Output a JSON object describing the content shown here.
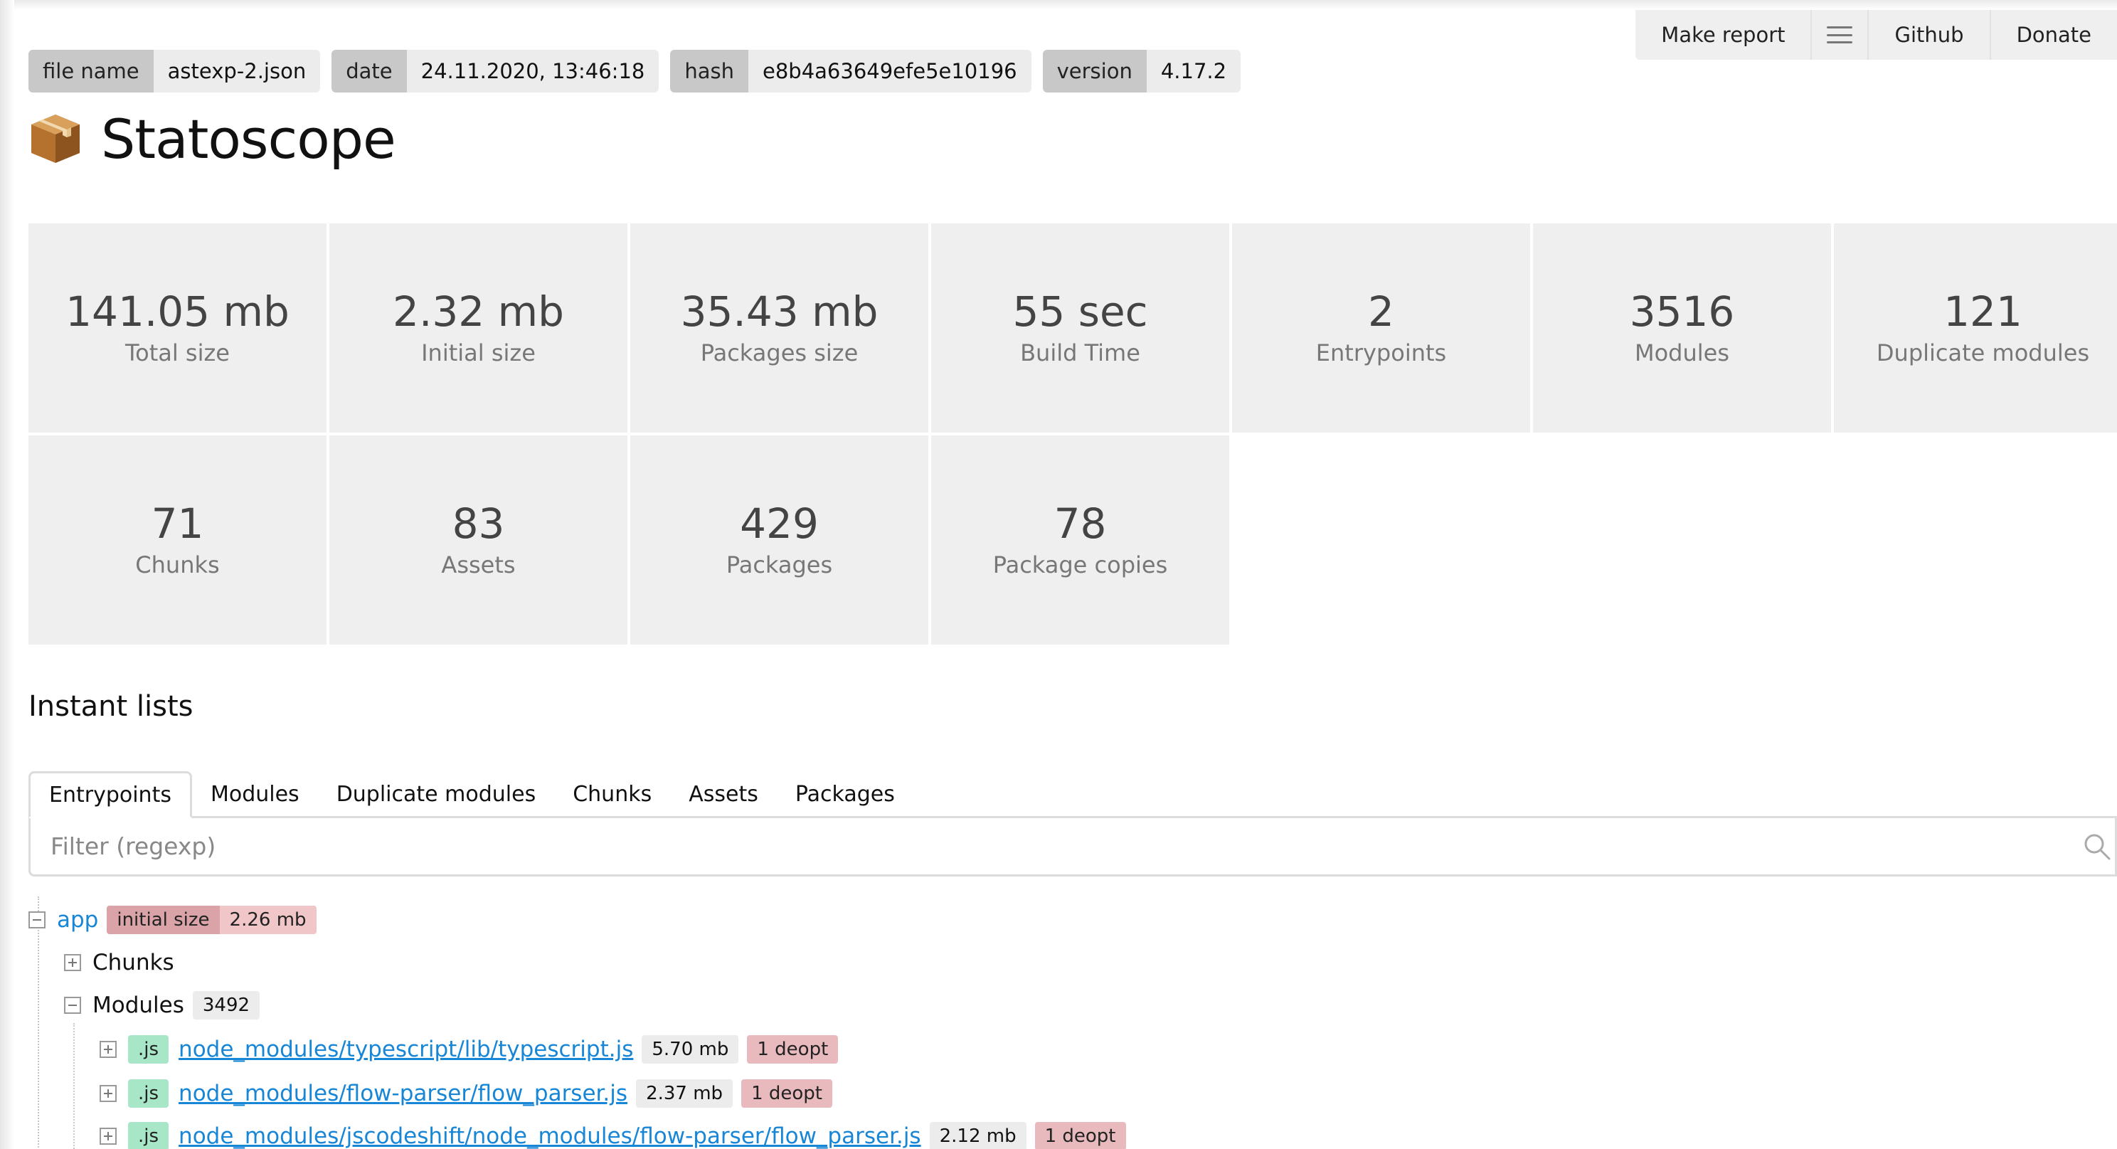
{
  "nav": {
    "make_report": "Make report",
    "github": "Github",
    "donate": "Donate"
  },
  "meta": {
    "file_name": {
      "key": "file name",
      "value": "astexp-2.json"
    },
    "date": {
      "key": "date",
      "value": "24.11.2020, 13:46:18"
    },
    "hash": {
      "key": "hash",
      "value": "e8b4a63649efe5e10196"
    },
    "version": {
      "key": "version",
      "value": "4.17.2"
    }
  },
  "app_title": "Statoscope",
  "stats": [
    {
      "value": "141.05 mb",
      "label": "Total size"
    },
    {
      "value": "2.32 mb",
      "label": "Initial size"
    },
    {
      "value": "35.43 mb",
      "label": "Packages size"
    },
    {
      "value": "55 sec",
      "label": "Build Time"
    },
    {
      "value": "2",
      "label": "Entrypoints"
    },
    {
      "value": "3516",
      "label": "Modules"
    },
    {
      "value": "121",
      "label": "Duplicate modules"
    },
    {
      "value": "71",
      "label": "Chunks"
    },
    {
      "value": "83",
      "label": "Assets"
    },
    {
      "value": "429",
      "label": "Packages"
    },
    {
      "value": "78",
      "label": "Package copies"
    }
  ],
  "instant_lists": {
    "title": "Instant lists",
    "tabs": [
      "Entrypoints",
      "Modules",
      "Duplicate modules",
      "Chunks",
      "Assets",
      "Packages"
    ],
    "active_tab": "Entrypoints",
    "filter_placeholder": "Filter (regexp)",
    "filter_value": ""
  },
  "tree": {
    "root": {
      "name": "app",
      "size_key": "initial size",
      "size_value": "2.26 mb"
    },
    "chunks_label": "Chunks",
    "modules_label": "Modules",
    "modules_count": "3492",
    "modules": [
      {
        "ext": ".js",
        "path": "node_modules/typescript/lib/typescript.js",
        "size": "5.70 mb",
        "deopt": "1 deopt"
      },
      {
        "ext": ".js",
        "path": "node_modules/flow-parser/flow_parser.js",
        "size": "2.37 mb",
        "deopt": "1 deopt"
      },
      {
        "ext": ".js",
        "path": "node_modules/jscodeshift/node_modules/flow-parser/flow_parser.js",
        "size": "2.12 mb",
        "deopt": "1 deopt"
      }
    ]
  },
  "colors": {
    "link": "#1786d6",
    "panel": "#efefef",
    "deopt_badge": "#e8b9bd",
    "js_badge": "#a8e6c8"
  }
}
